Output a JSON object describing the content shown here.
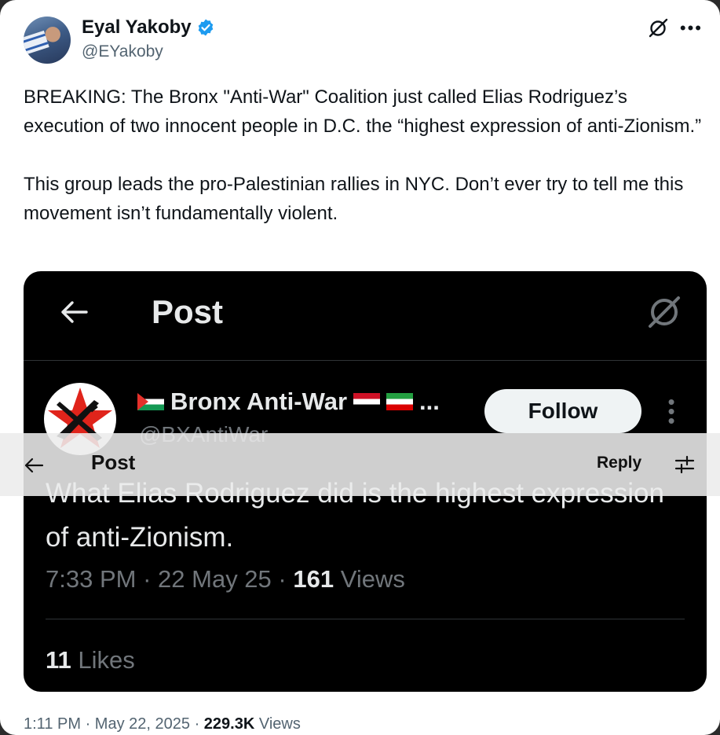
{
  "author": {
    "name": "Eyal Yakoby",
    "handle": "@EYakoby",
    "verified": true,
    "verified_color": "#1d9bf0"
  },
  "tweet": {
    "text": "BREAKING: The Bronx \"Anti-War\" Coalition just called Elias Rodriguez’s execution of two innocent people in D.C. the “highest expression of anti-Zionism.”\n\nThis group leads the pro-Palestinian rallies in NYC. Don’t ever try to tell me this movement isn’t fundamentally violent.",
    "time": "1:11 PM",
    "date": "May 22, 2025",
    "views": "229.3K",
    "views_label": "Views",
    "sep": "·"
  },
  "icons": {
    "grok": "grok-icon",
    "more": "more-icon",
    "back": "back-arrow-icon",
    "kebab": "kebab-icon",
    "adjust": "adjust-icon"
  },
  "embedded": {
    "header_title": "Post",
    "account_name": "Bronx Anti-War",
    "account_name_suffix": "...",
    "account_handle": "@BXAntiWar",
    "follow_label": "Follow",
    "post_text": "What Elias Rodriguez did is the highest expression of anti-Zionism.",
    "time": "7:33 PM",
    "date": "22 May 25",
    "sep": "·",
    "views": "161",
    "views_label": "Views",
    "likes": "11",
    "likes_label": "Likes"
  },
  "overlay_bar": {
    "title": "Post",
    "reply_label": "Reply"
  },
  "colors": {
    "text_primary": "#0f1419",
    "text_secondary": "#536471",
    "dark_bg": "#000000",
    "dark_text": "#e7e9ea",
    "dark_muted": "#71767b",
    "logo_red": "#e0241b"
  }
}
